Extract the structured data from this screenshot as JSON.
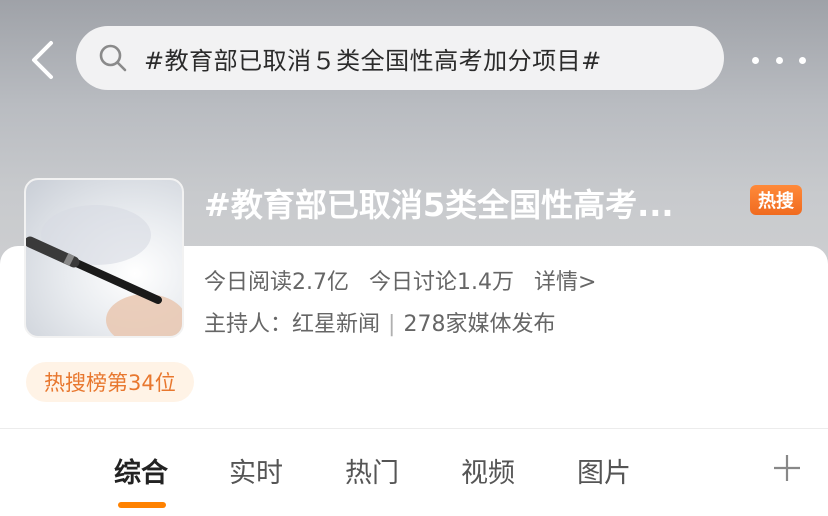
{
  "header": {
    "back_icon": "chevron-left-icon",
    "search_icon": "search-icon",
    "search_query": "#教育部已取消５类全国性高考加分项目#",
    "more_icon": "more-horizontal-icon"
  },
  "topic": {
    "title": "#教育部已取消5类全国性高考...",
    "badge": "热搜",
    "read_label": "今日阅读2.7亿",
    "discuss_label": "今日讨论1.4万",
    "details_link": "详情>",
    "host_label": "主持人：",
    "host_name": "红星新闻",
    "media_count": "278家媒体发布",
    "rank_label": "热搜榜第34位"
  },
  "tabs": [
    {
      "label": "综合",
      "active": true
    },
    {
      "label": "实时",
      "active": false
    },
    {
      "label": "热门",
      "active": false
    },
    {
      "label": "视频",
      "active": false
    },
    {
      "label": "图片",
      "active": false
    }
  ],
  "colors": {
    "accent": "#ff8200",
    "badge": "#f06a1f",
    "rank_text": "#e8772e",
    "rank_bg": "#fff3e6"
  },
  "add_tab_icon": "plus-icon"
}
